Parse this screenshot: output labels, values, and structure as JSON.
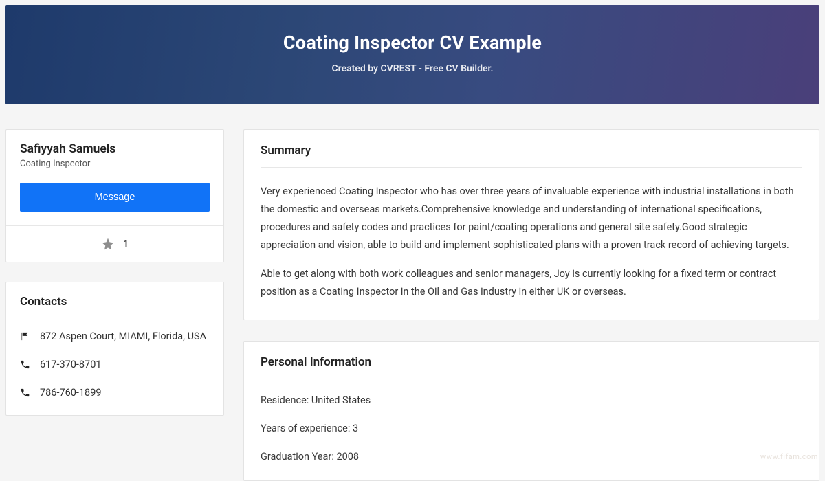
{
  "hero": {
    "title": "Coating Inspector CV Example",
    "subtitle": "Created by CVREST - Free CV Builder."
  },
  "profile": {
    "name": "Safiyyah Samuels",
    "role": "Coating Inspector",
    "message_label": "Message",
    "rating": "1"
  },
  "contacts": {
    "heading": "Contacts",
    "address": "872 Aspen Court, MIAMI, Florida, USA",
    "phone1": "617-370-8701",
    "phone2": "786-760-1899"
  },
  "summary": {
    "heading": "Summary",
    "para1": "Very experienced Coating Inspector who has over three years of invaluable experience with industrial installations in both the domestic and overseas markets.Comprehensive knowledge and understanding of international specifications, procedures and safety codes and practices for paint/coating operations and general site safety.Good strategic appreciation and vision, able to build and implement sophisticated plans with a proven track record of achieving targets.",
    "para2": "Able to get along with both work colleagues and senior managers, Joy is currently looking for a fixed term or contract position as a Coating Inspector in the Oil and Gas industry in either UK or overseas."
  },
  "personal": {
    "heading": "Personal Information",
    "residence_label": "Residence: ",
    "residence_value": "United States",
    "years_label": "Years of experience: ",
    "years_value": "3",
    "grad_label": "Graduation Year: ",
    "grad_value": "2008"
  },
  "watermark": "www.fifam.com"
}
